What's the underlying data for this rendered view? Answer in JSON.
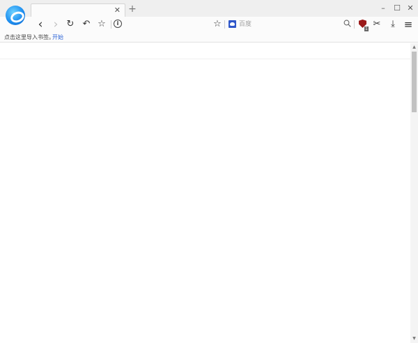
{
  "window": {
    "tab_close_glyph": "✕",
    "new_tab_glyph": "+",
    "minimize_glyph": "–",
    "maximize_glyph": "☐",
    "close_glyph": "✕"
  },
  "toolbar": {
    "back_glyph": "‹",
    "forward_glyph": "›",
    "reload_glyph": "↻",
    "undo_glyph": "↶",
    "star_glyph": "☆",
    "address_value": "",
    "site_info_glyph": "i",
    "bookmark_star_glyph": "☆",
    "search_placeholder": "百度",
    "ublock_badge": "1",
    "scissors_glyph": "✂",
    "download_glyph": "⤓",
    "menu_glyph": "≡"
  },
  "bookmarks_bar": {
    "hint_text": "点击这里导入书签。",
    "start_link": "开始"
  },
  "scrollbar": {
    "up_glyph": "▲",
    "down_glyph": "▼"
  },
  "icons": {
    "browser_logo": "browser-logo-icon",
    "site_info": "info-icon",
    "search_engine": "baidu-paw-icon",
    "search": "search-icon",
    "ublock": "ublock-origin-icon",
    "screenshot": "scissors-icon",
    "download": "download-icon",
    "menu": "hamburger-menu-icon"
  },
  "colors": {
    "titlebar": "#efefef",
    "toolbar": "#fbfbfb",
    "link": "#2a62d6",
    "logo": "#1e8ff0",
    "baidu": "#2f57c9",
    "ublock": "#9b1a1a"
  }
}
